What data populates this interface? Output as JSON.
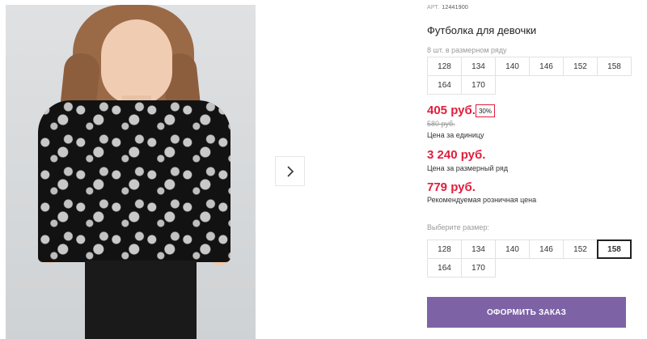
{
  "product": {
    "art_label": "АРТ.",
    "art_code": "12441900",
    "title": "Футболка для девочки",
    "row_note": "8 шт. в размерном ряду",
    "row_sizes": [
      "128",
      "134",
      "140",
      "146",
      "152",
      "158",
      "164",
      "170"
    ]
  },
  "prices": {
    "unit_price": "405 руб.",
    "discount": "30%",
    "old_price": "580 руб.",
    "unit_note": "Цена за единицу",
    "row_price": "3 240 руб.",
    "row_note": "Цена за размерный ряд",
    "rrp": "779 руб.",
    "rrp_note": "Рекомендуемая розничная цена"
  },
  "size_picker": {
    "label": "Выберите размер:",
    "sizes": [
      "128",
      "134",
      "140",
      "146",
      "152",
      "158",
      "164",
      "170"
    ],
    "selected": "158"
  },
  "actions": {
    "order_label": "ОФОРМИТЬ ЗАКАЗ"
  },
  "icons": {
    "next": "chevron-right-icon"
  },
  "colors": {
    "price_red": "#e01e3c",
    "order_button": "#7d63a6"
  }
}
